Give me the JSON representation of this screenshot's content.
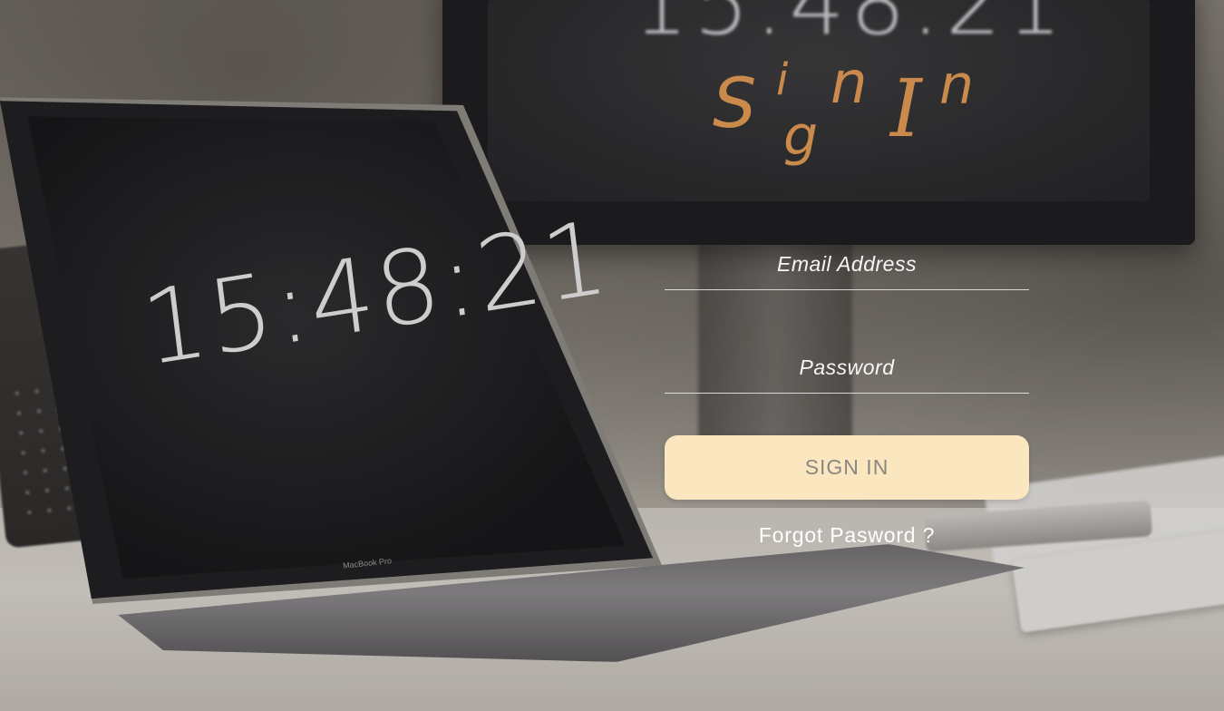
{
  "header": {
    "title_letters": [
      "S",
      "i",
      "g",
      "n",
      "I",
      "n"
    ],
    "title_color": "#c98a4b"
  },
  "form": {
    "email_placeholder": "Email Address",
    "password_placeholder": "Password",
    "signin_label": "SIGN IN",
    "forgot_label": "Forgot Pasword ?",
    "button_color": "#fae7c0"
  },
  "background": {
    "laptop_clock": "15:48:21",
    "monitor_clock": "15:48:21",
    "laptop_brand": "MacBook Pro"
  }
}
